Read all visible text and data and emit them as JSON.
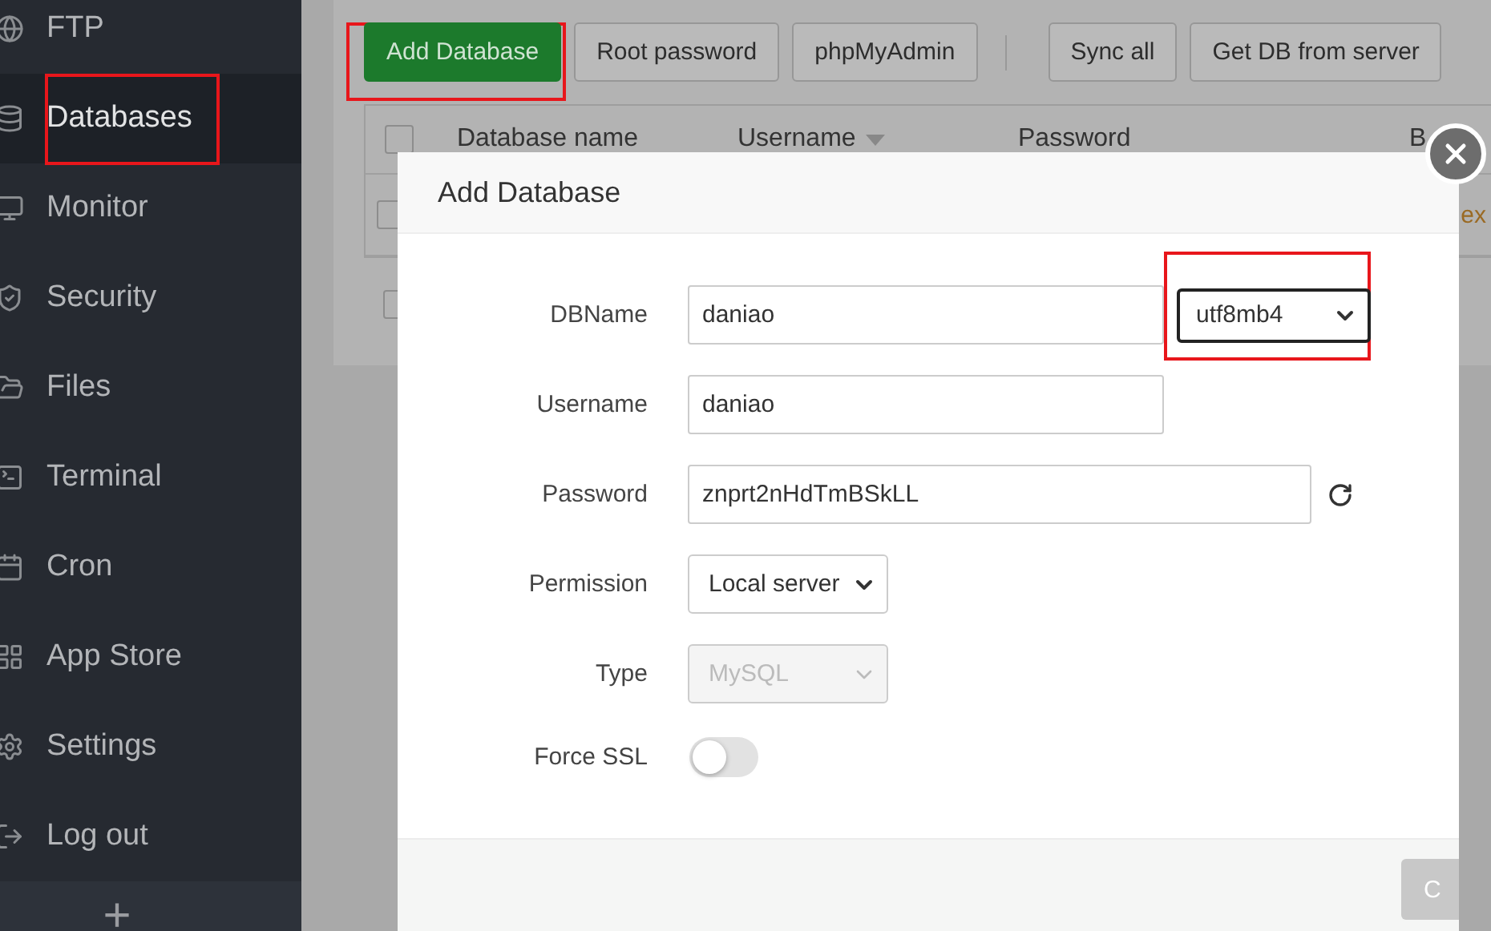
{
  "sidebar": {
    "items": [
      {
        "label": "FTP",
        "selected": false
      },
      {
        "label": "Databases",
        "selected": true
      },
      {
        "label": "Monitor",
        "selected": false
      },
      {
        "label": "Security",
        "selected": false
      },
      {
        "label": "Files",
        "selected": false
      },
      {
        "label": "Terminal",
        "selected": false
      },
      {
        "label": "Cron",
        "selected": false
      },
      {
        "label": "App Store",
        "selected": false
      },
      {
        "label": "Settings",
        "selected": false
      },
      {
        "label": "Log out",
        "selected": false
      }
    ],
    "add_label": "+"
  },
  "toolbar": {
    "groups": [
      [
        {
          "label": "Add Database",
          "kind": "primary"
        },
        {
          "label": "Root password",
          "kind": "default"
        },
        {
          "label": "phpMyAdmin",
          "kind": "default"
        }
      ],
      [
        {
          "label": "Sync all",
          "kind": "default"
        },
        {
          "label": "Get DB from server",
          "kind": "default"
        }
      ]
    ]
  },
  "table": {
    "header_checked": false,
    "columns": [
      {
        "label": "Database name",
        "sorted": false
      },
      {
        "label": "Username",
        "sorted": true
      },
      {
        "label": "Password",
        "sorted": false
      }
    ],
    "column_4": "B",
    "rows": [
      {
        "checked": false,
        "note": "ex"
      }
    ],
    "footer_checked": false
  },
  "modal": {
    "title": "Add Database",
    "fields": [
      {
        "kind": "text",
        "label": "DBName",
        "value": "daniao",
        "addon": "utf8mb4"
      },
      {
        "kind": "text",
        "label": "Username",
        "value": "daniao"
      },
      {
        "kind": "password",
        "label": "Password",
        "value": "znprt2nHdTmBSkLL"
      },
      {
        "kind": "select",
        "label": "Permission",
        "value": "Local server",
        "disabled": false
      },
      {
        "kind": "select",
        "label": "Type",
        "value": "MySQL",
        "disabled": true
      },
      {
        "kind": "toggle",
        "label": "Force SSL",
        "on": false
      }
    ],
    "footer_buttons": [
      {
        "label": "C"
      }
    ]
  }
}
